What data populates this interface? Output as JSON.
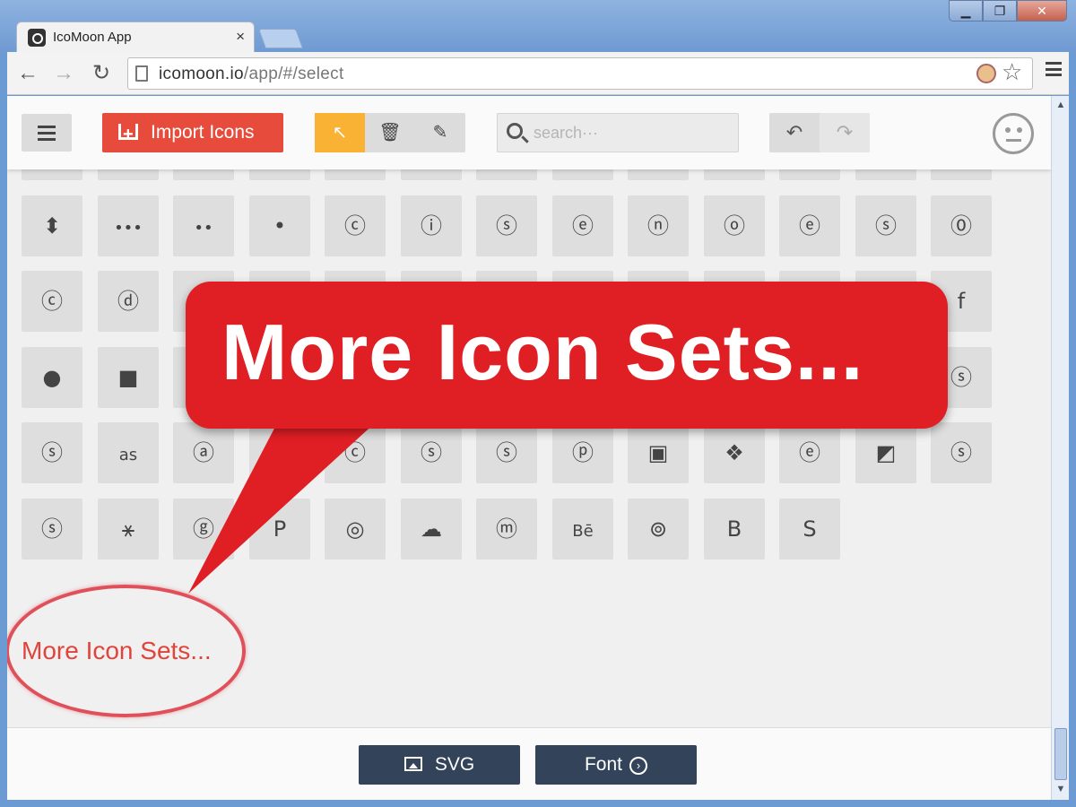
{
  "browser": {
    "tab_title": "IcoMoon App",
    "tab_close": "×",
    "url_host": "icomoon.io",
    "url_path": "/app/#/select",
    "back": "←",
    "forward": "→",
    "reload": "↻",
    "star": "☆",
    "min": "▁",
    "max": "❐",
    "close": "✕"
  },
  "appbar": {
    "import_label": "Import Icons",
    "search_placeholder": "search···",
    "mode_select": "↖",
    "mode_delete": "🗑",
    "mode_edit": "✎",
    "undo": "↶",
    "redo": "↷"
  },
  "grid": {
    "rows": [
      [
        "›",
        "‹",
        "⌄",
        "⌃",
        "›",
        "〈",
        "﹀",
        "︿",
        "〉",
        "⟵",
        "↓",
        "↑",
        "⟶"
      ],
      [
        "⬍",
        "•••",
        "••",
        "•",
        "ⓒ",
        "ⓘ",
        "ⓢ",
        "ⓔ",
        "ⓝ",
        "ⓞ",
        "ⓔ",
        "ⓢ",
        "⓪"
      ],
      [
        "ⓒ",
        "ⓓ",
        "",
        "",
        "",
        "",
        "",
        "",
        "",
        "",
        "",
        "",
        "f"
      ],
      [
        "●",
        "■",
        "",
        "",
        "",
        "",
        "",
        "",
        "",
        "",
        "",
        "",
        "ⓢ"
      ],
      [
        "ⓢ",
        "as",
        "ⓐ",
        "",
        "ⓒ",
        "ⓢ",
        "ⓢ",
        "ⓟ",
        "▣",
        "❖",
        "ⓔ",
        "◩",
        "ⓢ"
      ],
      [
        "ⓢ",
        "⚹",
        "ⓖ",
        "P",
        "◎",
        "☁",
        "ⓜ",
        "Bē",
        "⊚",
        "B",
        "S"
      ]
    ]
  },
  "more_link": "More Icon Sets...",
  "callout_text": "More Icon Sets...",
  "bottom": {
    "svg_label": "SVG",
    "font_label": "Font"
  },
  "colors": {
    "import": "#e64b3c",
    "select_mode": "#f9b233",
    "callout": "#e01f25",
    "bottom_buttons": "#33445a"
  }
}
